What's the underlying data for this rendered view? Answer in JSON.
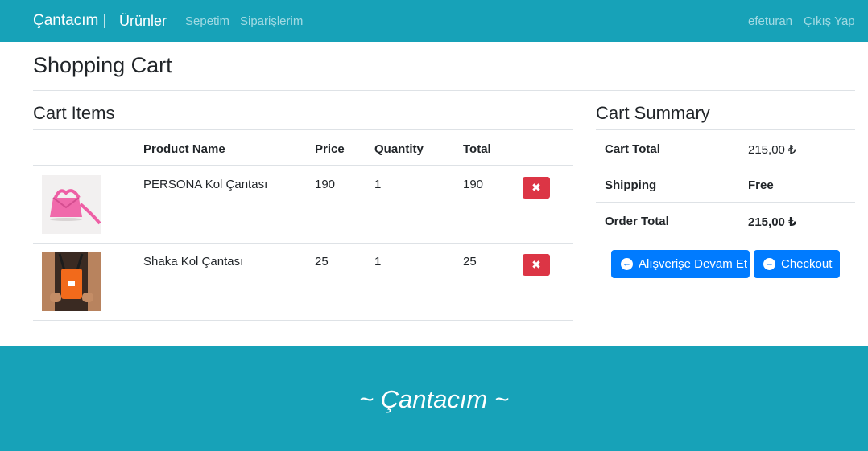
{
  "navbar": {
    "brand": "Çantacım |",
    "products": "Ürünler",
    "cart": "Sepetim",
    "orders": "Siparişlerim",
    "username": "efeturan",
    "logout": "Çıkış Yap"
  },
  "page": {
    "title": "Shopping Cart"
  },
  "cart": {
    "title": "Cart Items",
    "headers": {
      "name": "Product Name",
      "price": "Price",
      "quantity": "Quantity",
      "total": "Total"
    },
    "items": [
      {
        "name": "PERSONA Kol Çantası",
        "price": "190",
        "quantity": "1",
        "total": "190",
        "delete_icon": "✖",
        "image": "pink-handbag"
      },
      {
        "name": "Shaka Kol Çantası",
        "price": "25",
        "quantity": "1",
        "total": "25",
        "delete_icon": "✖",
        "image": "orange-crossbody-bag"
      }
    ]
  },
  "summary": {
    "title": "Cart Summary",
    "cart_total_label": "Cart Total",
    "cart_total_value": "215,00 ₺",
    "shipping_label": "Shipping",
    "shipping_value": "Free",
    "order_total_label": "Order Total",
    "order_total_value": "215,00 ₺"
  },
  "actions": {
    "continue_label": "Alışverişe Devam Et",
    "continue_icon": "arrow-circle-left-icon",
    "checkout_label": "Checkout",
    "checkout_icon": "arrow-circle-right-icon"
  },
  "footer": {
    "text": "~ Çantacım ~"
  },
  "colors": {
    "navbar": "#17a2b8",
    "primary": "#007bff",
    "danger": "#dc3545"
  }
}
